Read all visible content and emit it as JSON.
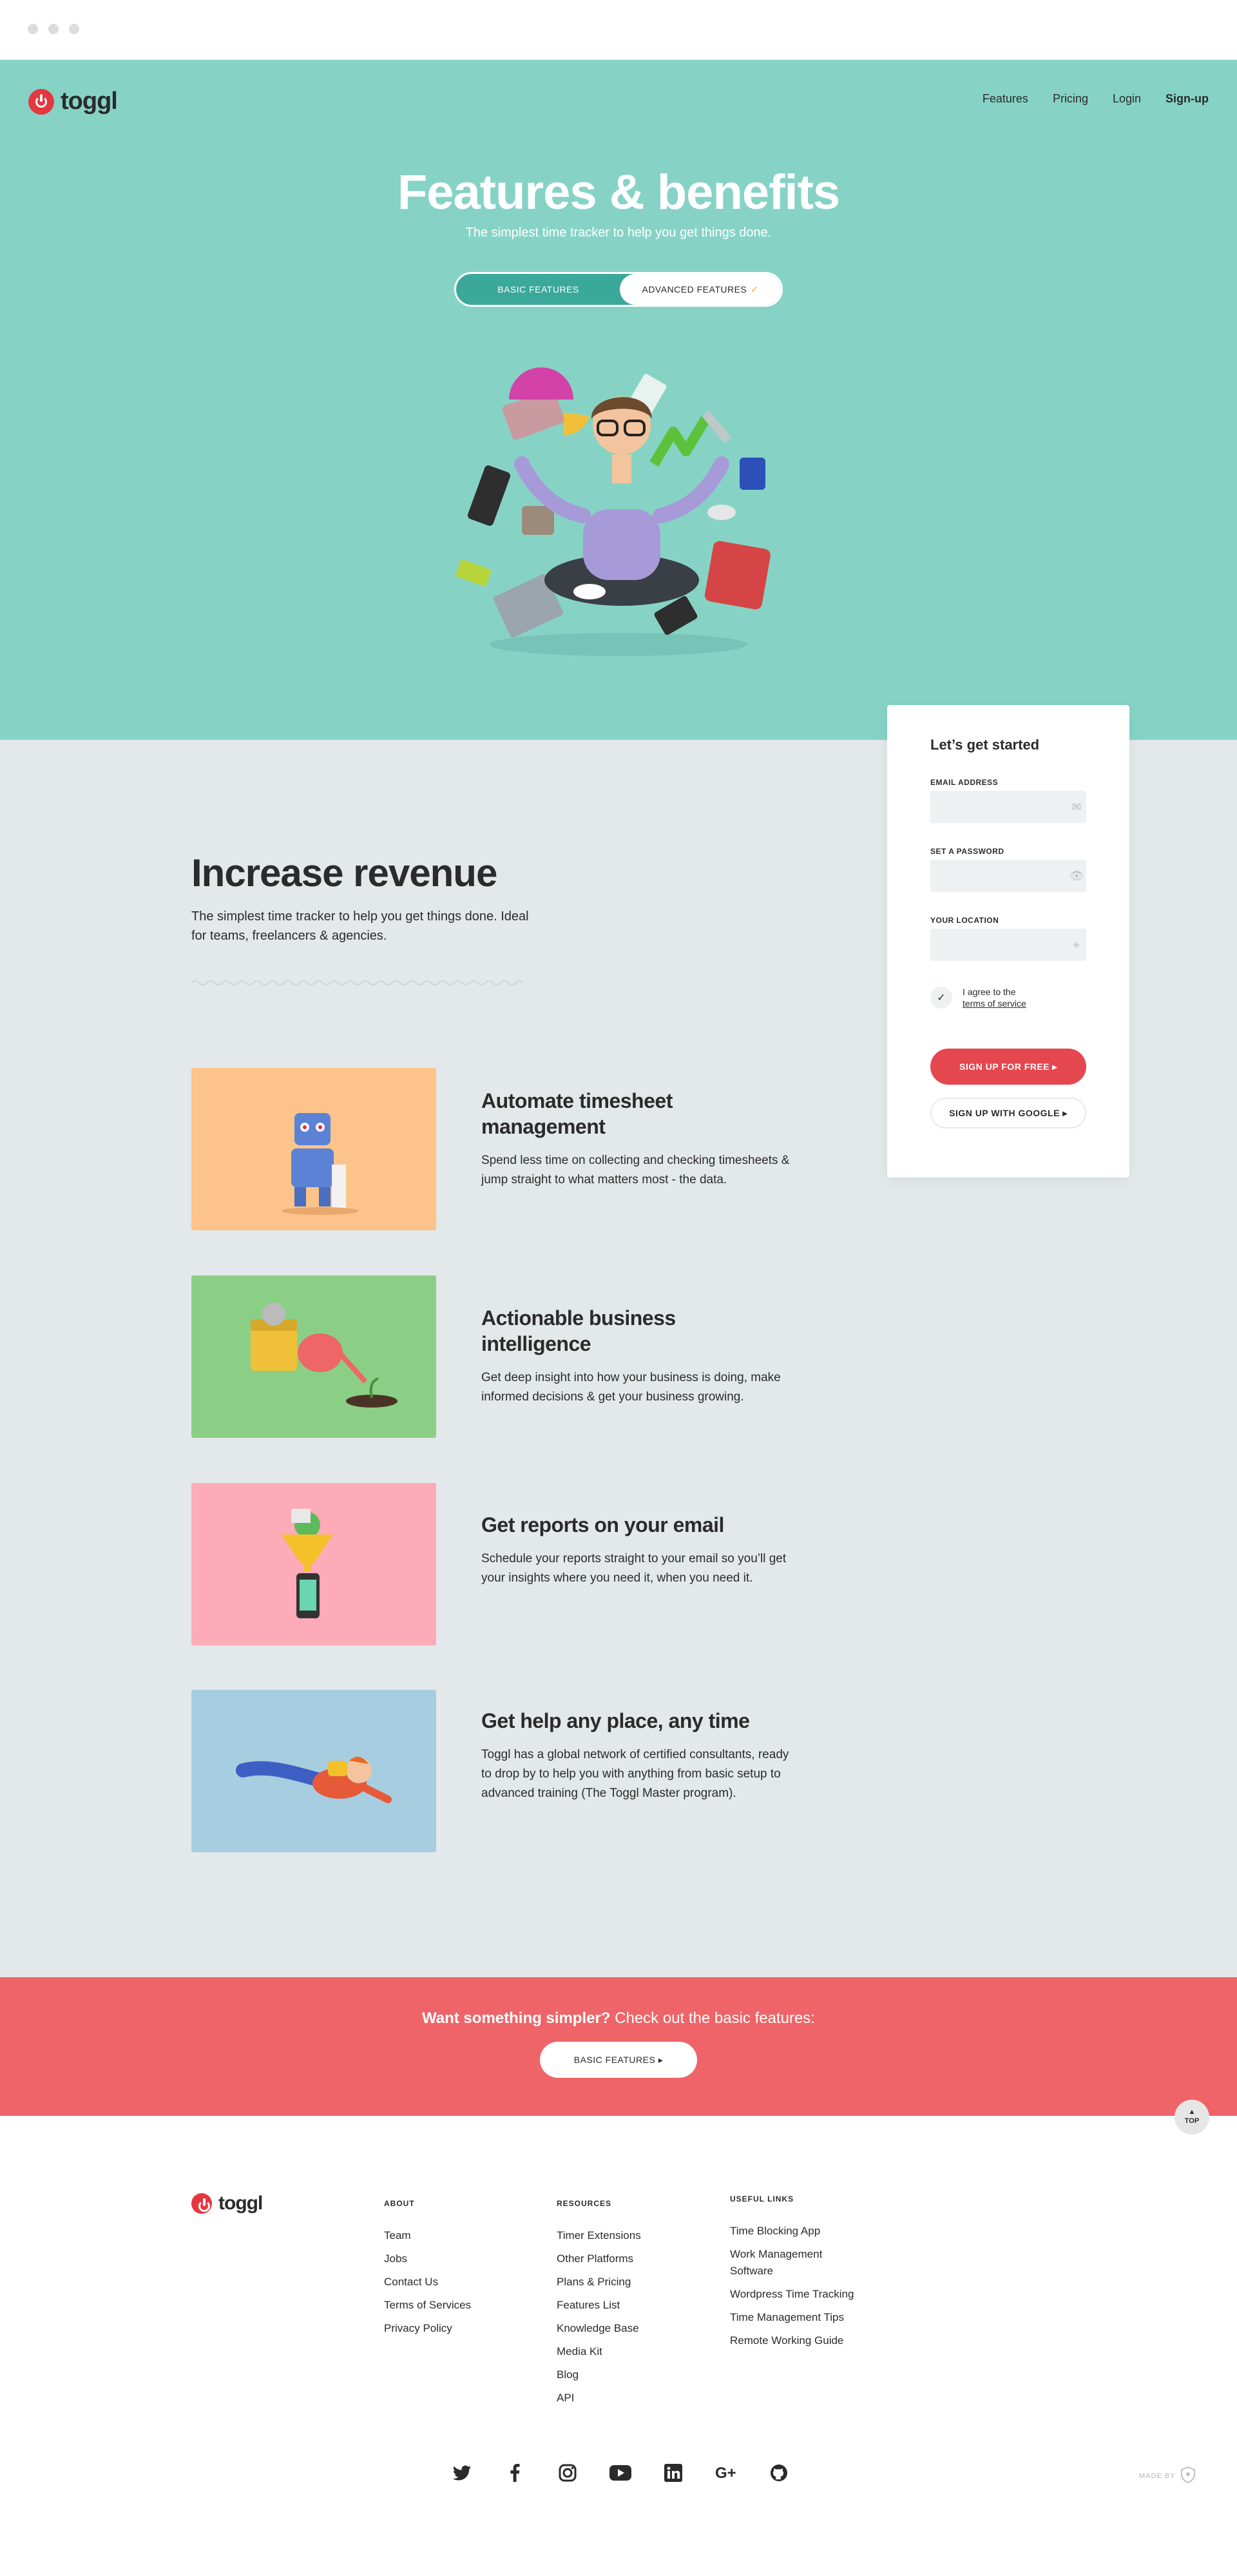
{
  "nav": {
    "logo_text": "toggl",
    "features": "Features",
    "pricing": "Pricing",
    "login": "Login",
    "signup": "Sign-up"
  },
  "hero": {
    "title": "Features & benefits",
    "subtitle": "The simplest time tracker to help you get things done.",
    "toggle_basic": "BASIC FEATURES",
    "toggle_advanced": "ADVANCED FEATURES"
  },
  "signup_card": {
    "title": "Let’s get started",
    "email_label": "EMAIL ADDRESS",
    "password_label": "SET A PASSWORD",
    "location_label": "YOUR LOCATION",
    "agree_text": "I agree to the",
    "terms_link": "terms of service",
    "signup_button": "SIGN UP FOR FREE",
    "google_button": "SIGN UP WITH GOOGLE"
  },
  "revenue": {
    "title": "Increase revenue",
    "description": "The simplest time tracker to help you get things done. Ideal for teams, freelancers & agencies."
  },
  "features": [
    {
      "title": "Automate timesheet management",
      "description": "Spend less time on collecting and checking timesheets & jump straight to what matters most - the data.",
      "bg": "#fcc38b"
    },
    {
      "title": "Actionable business intelligence",
      "description": "Get deep insight into how your business is doing, make informed decisions & get your business growing.",
      "bg": "#8bcf87"
    },
    {
      "title": "Get reports on your email",
      "description": "Schedule your reports straight to your email so you’ll get your insights where you need it, when you need it.",
      "bg": "#fdaab9"
    },
    {
      "title": "Get help any place, any time",
      "description": "Toggl has a global network of certified consultants, ready to drop by to help you with anything from basic setup to advanced training (The Toggl Master program).",
      "bg": "#a7cde0"
    }
  ],
  "cta": {
    "bold": "Want something simpler?",
    "text": " Check out the basic features:",
    "button": "BASIC FEATURES"
  },
  "top_button": "TOP",
  "footer": {
    "logo_text": "toggl",
    "about": {
      "heading": "ABOUT",
      "links": [
        "Team",
        "Jobs",
        "Contact Us",
        "Terms of Services",
        "Privacy Policy"
      ]
    },
    "resources": {
      "heading": "RESOURCES",
      "links": [
        "Timer Extensions",
        "Other Platforms",
        "Plans & Pricing",
        "Features List",
        "Knowledge Base",
        "Media Kit",
        "Blog",
        "API"
      ]
    },
    "useful": {
      "heading": "USEFUL LINKS",
      "links": [
        "Time Blocking App",
        "Work Management Software",
        "Wordpress Time Tracking",
        "Time Management Tips",
        "Remote Working Guide"
      ]
    },
    "made_by": "MADE BY"
  },
  "colors": {
    "hero": "#86d3c6",
    "brand_red": "#e5373f",
    "cta": "#ee6468",
    "page_gray": "#e3e8ea"
  }
}
